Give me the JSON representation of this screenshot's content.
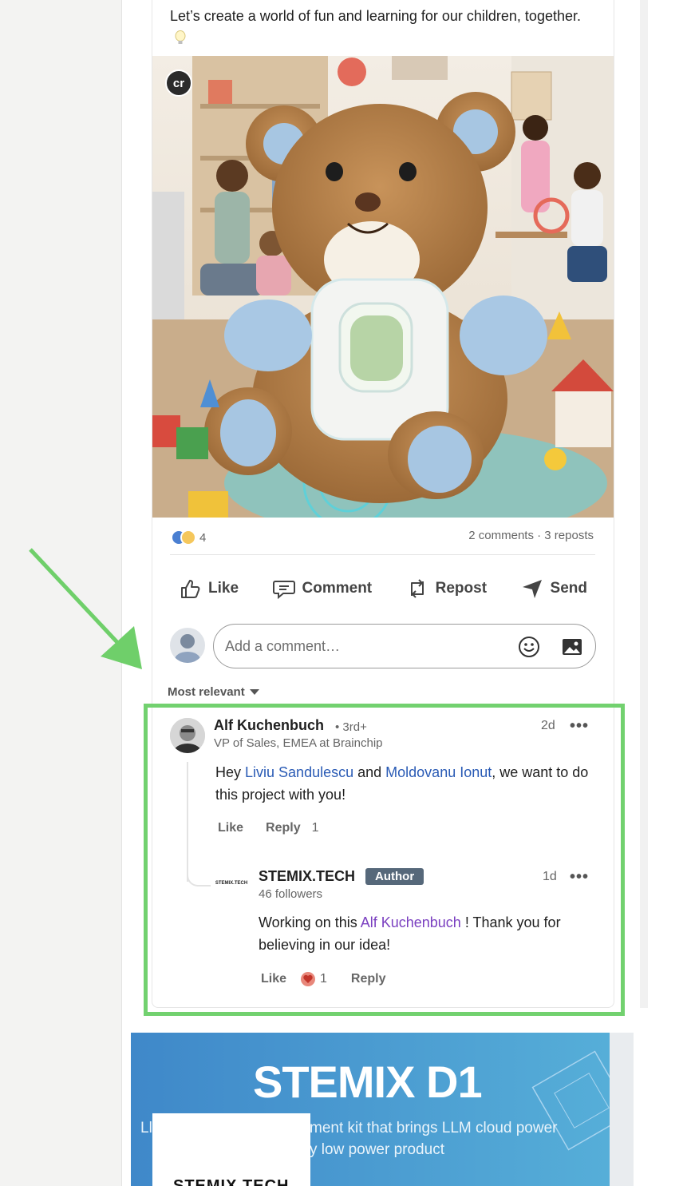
{
  "post": {
    "text": "Let’s create a world of fun and learning for our children, together.",
    "image_badge": "cr"
  },
  "social": {
    "reaction_count": "4",
    "counts": "2 comments · 3 reposts"
  },
  "actions": {
    "like": "Like",
    "comment": "Comment",
    "repost": "Repost",
    "send": "Send"
  },
  "comment_box": {
    "placeholder": "Add a comment…"
  },
  "sort": {
    "label": "Most relevant"
  },
  "comments": [
    {
      "author": "Alf Kuchenbuch",
      "degree": "• 3rd+",
      "headline": "VP of Sales, EMEA at Brainchip",
      "time": "2d",
      "text_pre": "Hey ",
      "mention1": "Liviu Sandulescu",
      "text_mid": " and ",
      "mention2": "Moldovanu Ionut",
      "text_post": ", we want to do this project with you!",
      "like_label": "Like",
      "reply_label": "Reply",
      "reply_count": "1",
      "more": "•••"
    }
  ],
  "reply": {
    "avatar_text": "STEMIX.TECH",
    "author": "STEMIX.TECH",
    "badge": "Author",
    "followers": "46 followers",
    "time": "1d",
    "text_pre": "Working on this ",
    "mention": "Alf Kuchenbuch",
    "text_post": " ! Thank you for believing in our idea!",
    "like_label": "Like",
    "like_count": "1",
    "reply_label": "Reply",
    "more": "•••"
  },
  "banner": {
    "title": "STEMIX D1",
    "lead": "Ll",
    "line1": "ment kit that brings LLM cloud power",
    "line2": "y low power product",
    "logo_text": "STEMIX.TECH"
  },
  "colors": {
    "highlight": "#72d16f",
    "mention": "#2a5bb5",
    "mention_purple": "#7a3fc0",
    "author_badge": "#56687a",
    "banner": "#3f88c9"
  }
}
